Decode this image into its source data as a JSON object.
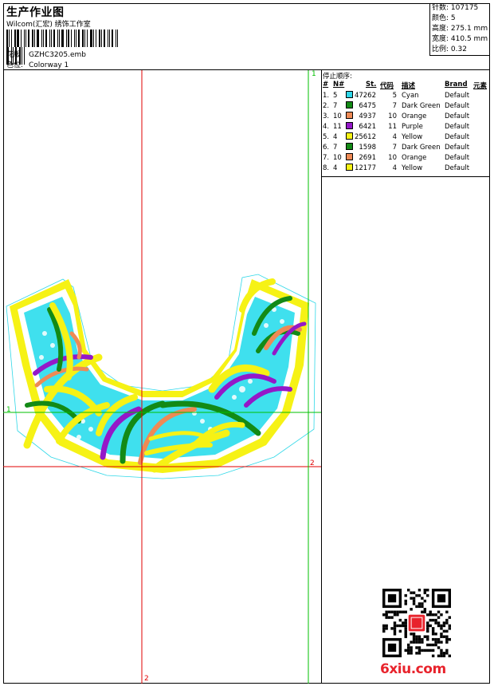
{
  "header": {
    "title": "生产作业图",
    "subtitle": "Wilcom(汇宏) 绣饰工作室",
    "file_label": "花版:",
    "file_value": "GZHC3205.emb",
    "colorway_label": "色位:",
    "colorway_value": "Colorway 1"
  },
  "stats": [
    {
      "label": "针数",
      "value": "107175"
    },
    {
      "label": "颜色",
      "value": "5"
    },
    {
      "label": "高度",
      "value": "275.1 mm"
    },
    {
      "label": "宽度",
      "value": "410.5 mm"
    },
    {
      "label": "比例",
      "value": "0.32"
    }
  ],
  "stop_table": {
    "title": "停止顺序:",
    "headers": {
      "num": "#",
      "needle": "N#",
      "stitches": "St.",
      "code": "代码",
      "desc": "描述",
      "brand": "Brand",
      "element": "元素"
    },
    "rows": [
      {
        "num": "1.",
        "needle": "5",
        "color": "#2fd6e8",
        "stitches": "47262",
        "code": "5",
        "desc": "Cyan",
        "brand": "Default"
      },
      {
        "num": "2.",
        "needle": "7",
        "color": "#138a16",
        "stitches": "6475",
        "code": "7",
        "desc": "Dark Green",
        "brand": "Default"
      },
      {
        "num": "3.",
        "needle": "10",
        "color": "#ee8a55",
        "stitches": "4937",
        "code": "10",
        "desc": "Orange",
        "brand": "Default"
      },
      {
        "num": "4.",
        "needle": "11",
        "color": "#9418c8",
        "stitches": "6421",
        "code": "11",
        "desc": "Purple",
        "brand": "Default"
      },
      {
        "num": "5.",
        "needle": "4",
        "color": "#f6f215",
        "stitches": "25612",
        "code": "4",
        "desc": "Yellow",
        "brand": "Default"
      },
      {
        "num": "6.",
        "needle": "7",
        "color": "#138a16",
        "stitches": "1598",
        "code": "7",
        "desc": "Dark Green",
        "brand": "Default"
      },
      {
        "num": "7.",
        "needle": "10",
        "color": "#ee8a55",
        "stitches": "2691",
        "code": "10",
        "desc": "Orange",
        "brand": "Default"
      },
      {
        "num": "8.",
        "needle": "4",
        "color": "#f6f215",
        "stitches": "12177",
        "code": "4",
        "desc": "Yellow",
        "brand": "Default"
      }
    ]
  },
  "guides": {
    "green_label_top": "1",
    "green_label_left": "1",
    "red_label_right": "2",
    "red_label_bottom": "2"
  },
  "watermark": {
    "text": "6xiu.com",
    "color": "#e8232c"
  },
  "colors": {
    "guide_red": "#e00000",
    "guide_green": "#00c000",
    "outline_cyan": "#30d8e8"
  }
}
